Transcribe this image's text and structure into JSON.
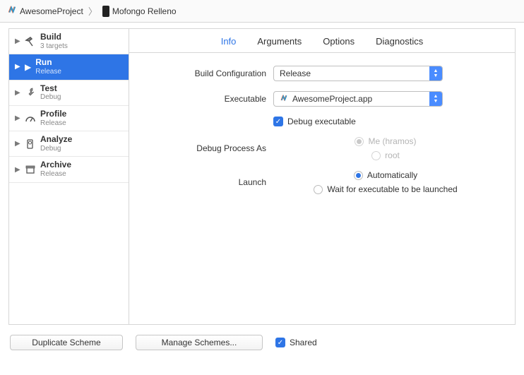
{
  "breadcrumb": {
    "project": "AwesomeProject",
    "target": "Mofongo Relleno"
  },
  "sidebar": {
    "items": [
      {
        "title": "Build",
        "sub": "3 targets",
        "icon": "hammer"
      },
      {
        "title": "Run",
        "sub": "Release",
        "icon": "play-full",
        "selected": true
      },
      {
        "title": "Test",
        "sub": "Debug",
        "icon": "wrench"
      },
      {
        "title": "Profile",
        "sub": "Release",
        "icon": "gauge"
      },
      {
        "title": "Analyze",
        "sub": "Debug",
        "icon": "analyze"
      },
      {
        "title": "Archive",
        "sub": "Release",
        "icon": "archive"
      }
    ]
  },
  "tabs": {
    "info": "Info",
    "arguments": "Arguments",
    "options": "Options",
    "diagnostics": "Diagnostics"
  },
  "form": {
    "buildConfig": {
      "label": "Build Configuration",
      "value": "Release"
    },
    "executable": {
      "label": "Executable",
      "value": "AwesomeProject.app"
    },
    "debugExe": {
      "label": "Debug executable"
    },
    "debugProcess": {
      "label": "Debug Process As",
      "opt1": "Me (hramos)",
      "opt2": "root"
    },
    "launch": {
      "label": "Launch",
      "opt1": "Automatically",
      "opt2": "Wait for executable to be launched"
    }
  },
  "footer": {
    "duplicate": "Duplicate Scheme",
    "manage": "Manage Schemes...",
    "shared": "Shared"
  }
}
